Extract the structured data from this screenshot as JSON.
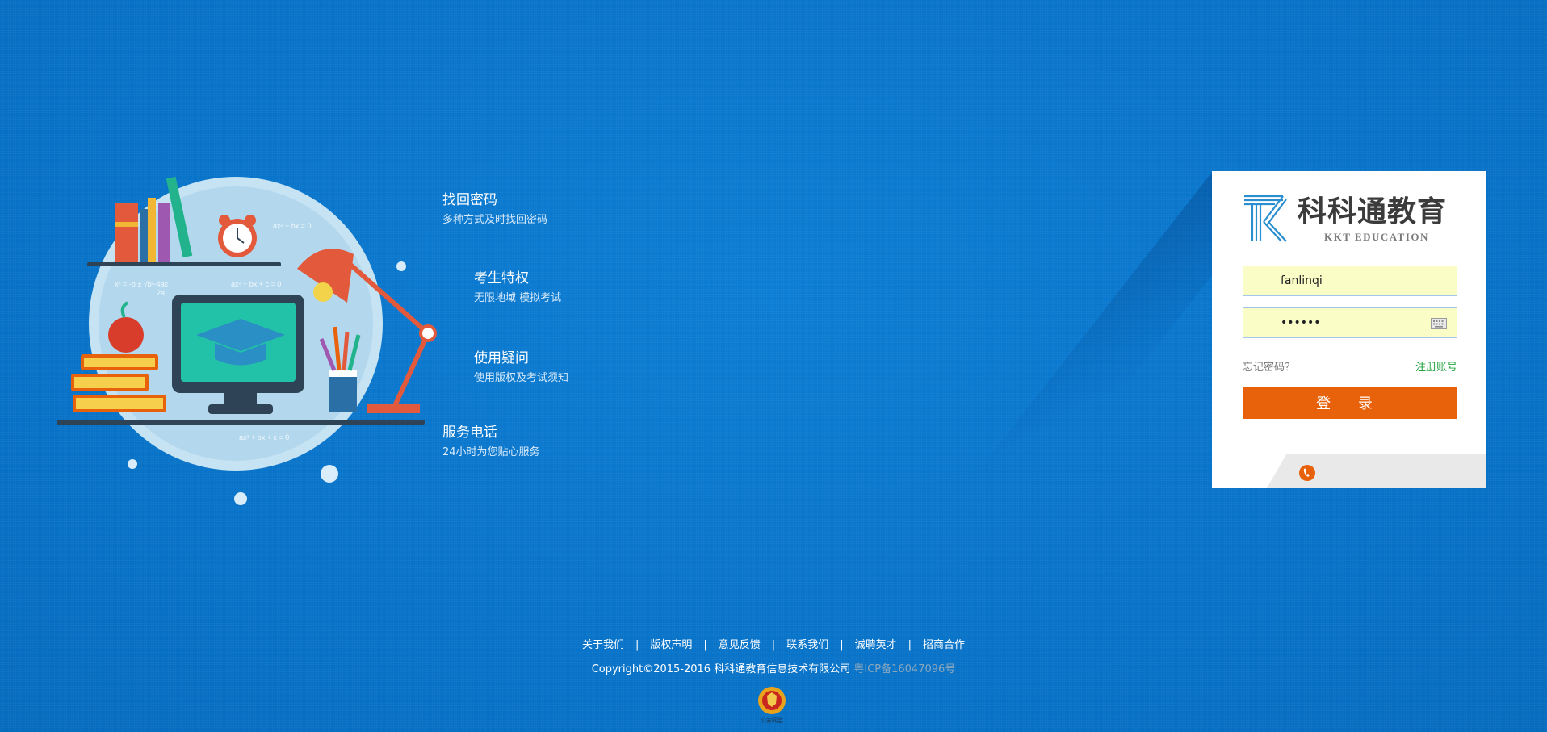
{
  "features": [
    {
      "title": "找回密码",
      "desc": "多种方式及时找回密码"
    },
    {
      "title": "考生特权",
      "desc": "无限地域 模拟考试"
    },
    {
      "title": "使用疑问",
      "desc": "使用版权及考试须知"
    },
    {
      "title": "服务电话",
      "desc": "24小时为您贴心服务"
    }
  ],
  "illustration": {
    "formula_1": "ax² + bx = 0",
    "formula_2": "x² = -b ± √b²-4ac",
    "formula_3": "2a",
    "formula_4": "ax² + bx + c = 0",
    "formula_5": "ax² + bx + c = 0"
  },
  "login": {
    "logo_text": "科科通教育",
    "logo_sub": "KKT EDUCATION",
    "username_value": "fanlinqi",
    "password_value": "fanlin",
    "forgot_label": "忘记密码？",
    "register_label": "注册账号",
    "login_button": "登 录"
  },
  "footer": {
    "links": [
      "关于我们",
      "版权声明",
      "意见反馈",
      "联系我们",
      "诚聘英才",
      "招商合作"
    ],
    "separator": "|",
    "copyright": "Copyright©2015-2016 科科通教育信息技术有限公司",
    "icp": "粤ICP备16047096号",
    "police_caption": "公安网监"
  },
  "colors": {
    "background": "#0a74c9",
    "login_button": "#e8610b",
    "register_link": "#21a33f",
    "input_fill": "#fbfdc7"
  }
}
